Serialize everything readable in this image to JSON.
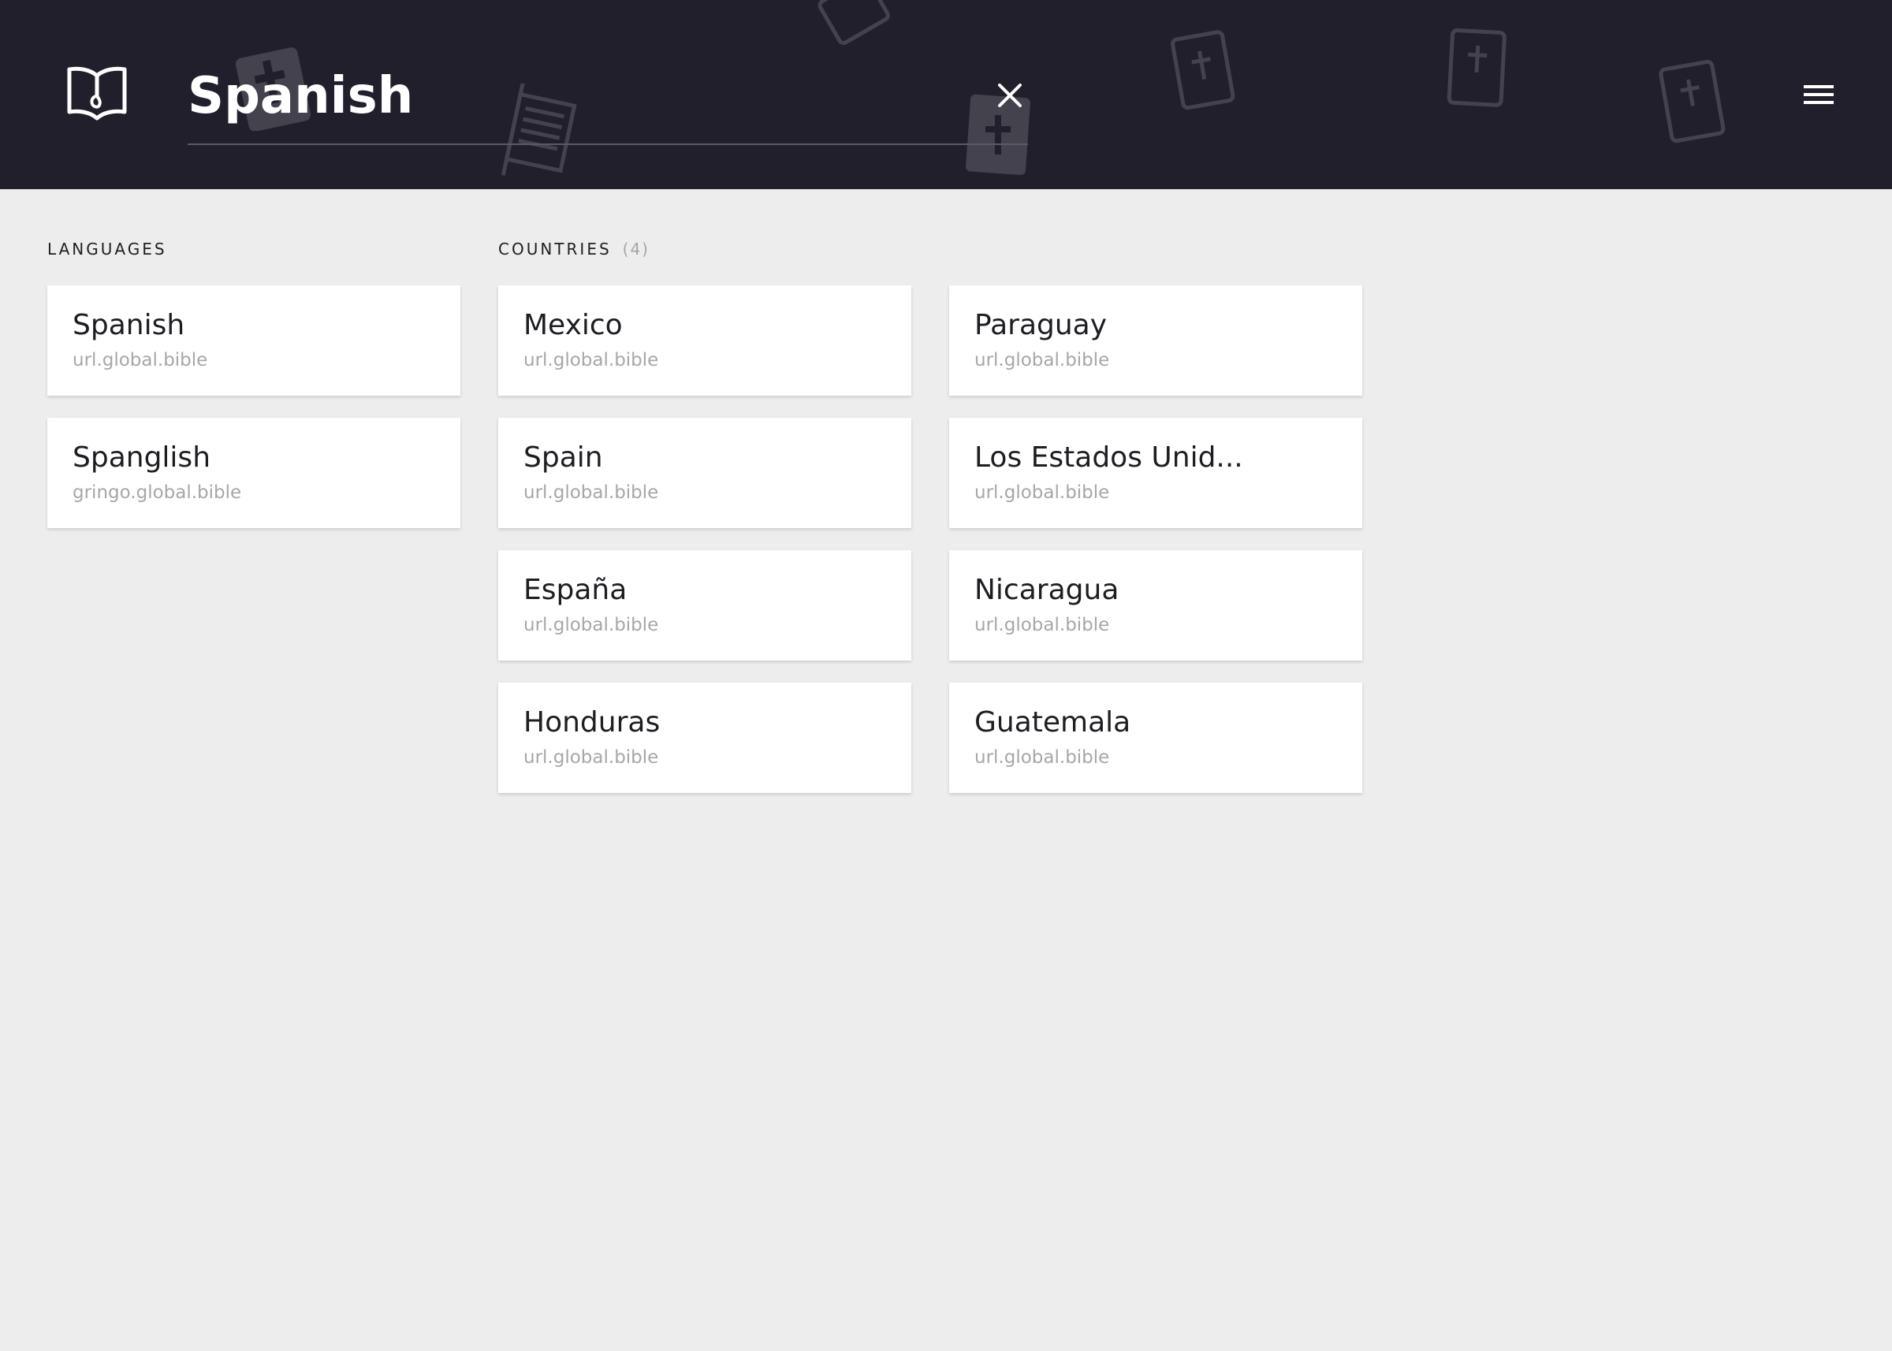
{
  "header": {
    "search_value": "Spanish",
    "clear_icon": "close-icon",
    "menu_icon": "hamburger-menu-icon",
    "logo_icon": "open-book-logo-icon",
    "background_color": "#201f2b"
  },
  "languages": {
    "label": "LANGUAGES",
    "items": [
      {
        "title": "Spanish",
        "url": "url.global.bible"
      },
      {
        "title": "Spanglish",
        "url": "gringo.global.bible"
      }
    ]
  },
  "countries": {
    "label": "COUNTRIES",
    "count": "(4)",
    "items": [
      {
        "title": "Mexico",
        "url": "url.global.bible"
      },
      {
        "title": "Paraguay",
        "url": "url.global.bible"
      },
      {
        "title": "Spain",
        "url": "url.global.bible"
      },
      {
        "title": "Los Estados Unid...",
        "url": "url.global.bible"
      },
      {
        "title": "España",
        "url": "url.global.bible"
      },
      {
        "title": "Nicaragua",
        "url": "url.global.bible"
      },
      {
        "title": "Honduras",
        "url": "url.global.bible"
      },
      {
        "title": "Guatemala",
        "url": "url.global.bible"
      }
    ]
  },
  "colors": {
    "page_background": "#ededed",
    "card_background": "#ffffff",
    "title_text": "#1d1d22",
    "subtitle_text": "#a7a7ab"
  }
}
